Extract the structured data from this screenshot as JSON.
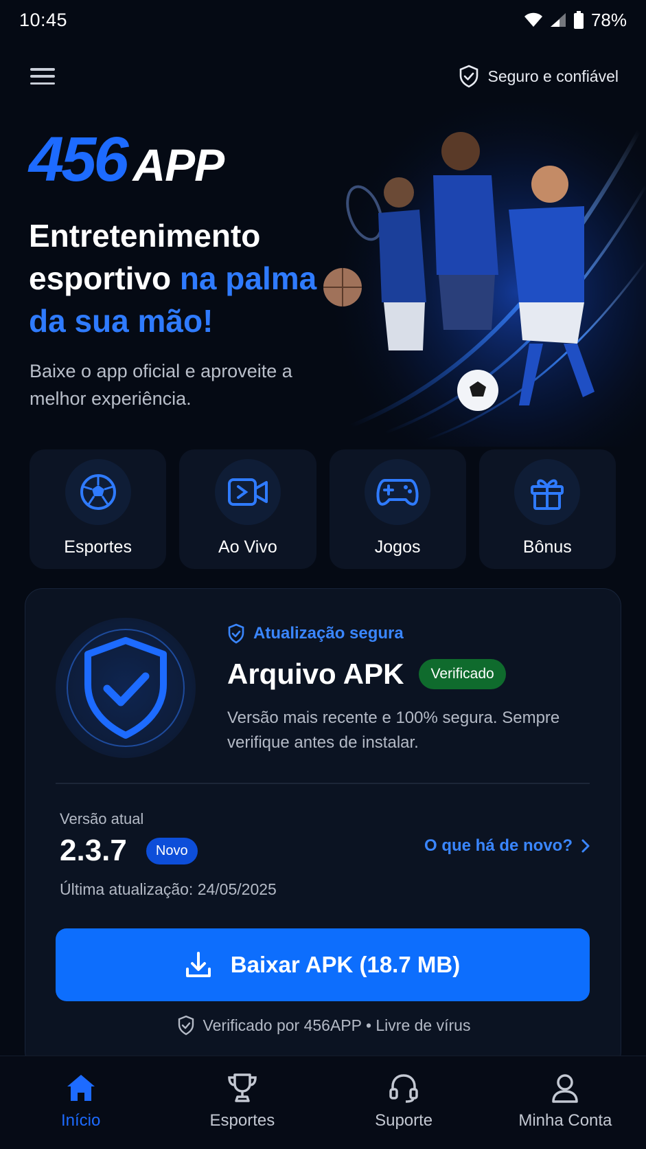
{
  "status_bar": {
    "time": "10:45",
    "battery": "78%"
  },
  "top_bar": {
    "secure_label": "Seguro e confiável"
  },
  "logo": {
    "number": "456",
    "suffix": "APP"
  },
  "hero": {
    "headline_white": "Entretenimento esportivo",
    "headline_accent_1": "na palma",
    "headline_accent_2": "da sua mão!",
    "subtitle": "Baixe o app oficial e aproveite a melhor experiência."
  },
  "quick_actions": [
    {
      "label": "Esportes",
      "icon": "soccer-ball-icon"
    },
    {
      "label": "Ao Vivo",
      "icon": "live-video-icon"
    },
    {
      "label": "Jogos",
      "icon": "gamepad-icon"
    },
    {
      "label": "Bônus",
      "icon": "gift-icon"
    }
  ],
  "apk_card": {
    "secure_update": "Atualização segura",
    "title": "Arquivo APK",
    "verified_badge": "Verificado",
    "description": "Versão mais recente e 100% segura. Sempre verifique antes de instalar.",
    "version_label": "Versão atual",
    "version_value": "2.3.7",
    "new_badge": "Novo",
    "last_update": "Última atualização: 24/05/2025",
    "whats_new": "O que há de novo?",
    "download_label": "Baixar APK (18.7 MB)",
    "verified_by": "Verificado por 456APP • Livre de vírus"
  },
  "bottom_nav": [
    {
      "label": "Início",
      "icon": "home-icon",
      "active": true
    },
    {
      "label": "Esportes",
      "icon": "trophy-icon",
      "active": false
    },
    {
      "label": "Suporte",
      "icon": "headset-icon",
      "active": false
    },
    {
      "label": "Minha Conta",
      "icon": "user-icon",
      "active": false
    }
  ],
  "colors": {
    "accent": "#1d6bff",
    "background": "#050a14",
    "card": "#0b1322",
    "success": "#0f6b2d"
  }
}
